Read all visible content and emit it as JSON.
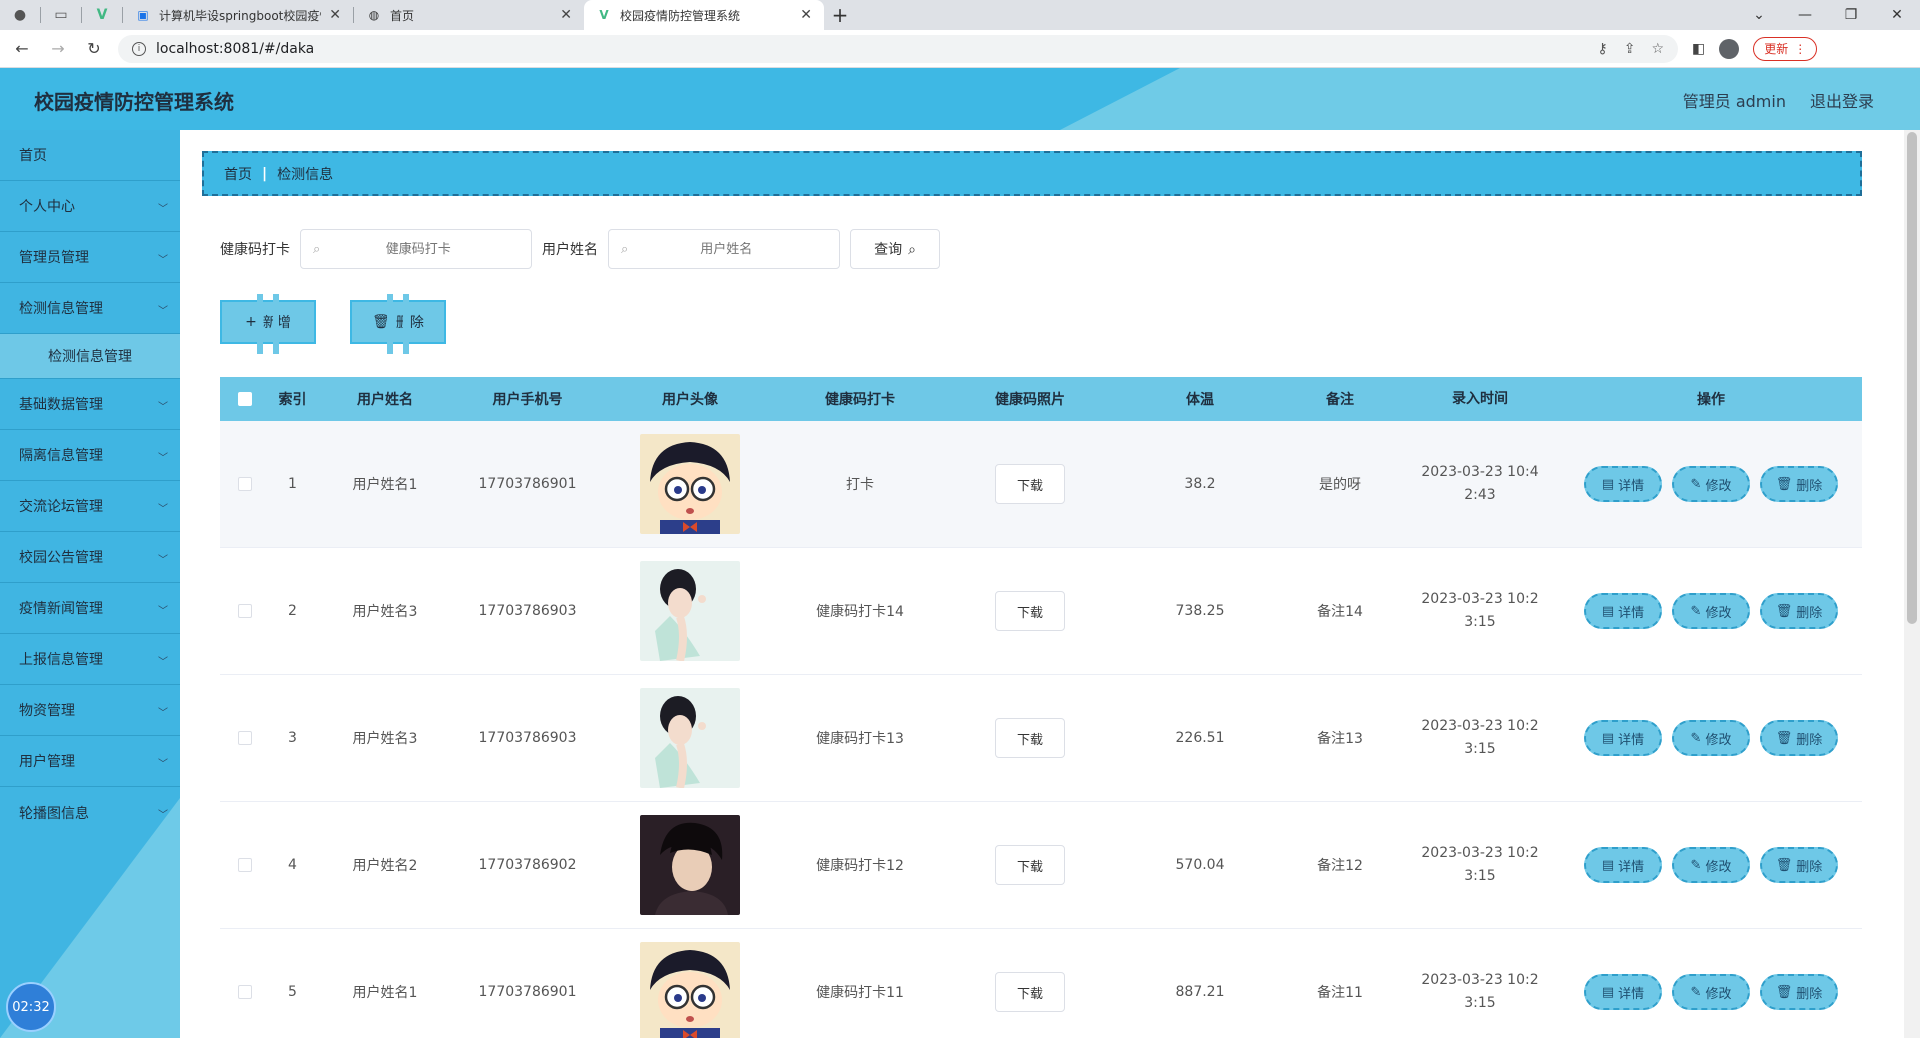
{
  "browser": {
    "tabs": [
      {
        "title": "计算机毕设springboot校园疫情",
        "icon": "calendar-icon"
      },
      {
        "title": "首页",
        "icon": "globe-icon"
      },
      {
        "title": "校园疫情防控管理系统",
        "icon": "vue-icon",
        "active": true
      }
    ],
    "url": "localhost:8081/#/daka",
    "update_label": "更新"
  },
  "header": {
    "title": "校园疫情防控管理系统",
    "user": "管理员 admin",
    "logout": "退出登录"
  },
  "sidebar": {
    "items": [
      {
        "label": "首页"
      },
      {
        "label": "个人中心"
      },
      {
        "label": "管理员管理"
      },
      {
        "label": "检测信息管理"
      },
      {
        "label": "检测信息管理",
        "sub": true
      },
      {
        "label": "基础数据管理"
      },
      {
        "label": "隔离信息管理"
      },
      {
        "label": "交流论坛管理"
      },
      {
        "label": "校园公告管理"
      },
      {
        "label": "疫情新闻管理"
      },
      {
        "label": "上报信息管理"
      },
      {
        "label": "物资管理"
      },
      {
        "label": "用户管理"
      },
      {
        "label": "轮播图信息"
      }
    ],
    "clock": "02:32"
  },
  "breadcrumb": {
    "home": "首页",
    "current": "检测信息"
  },
  "search": {
    "card_label": "健康码打卡",
    "card_placeholder": "健康码打卡",
    "name_label": "用户姓名",
    "name_placeholder": "用户姓名",
    "query_label": "查询"
  },
  "actions": {
    "add": "新增",
    "delete": "删除"
  },
  "table": {
    "headers": [
      "索引",
      "用户姓名",
      "用户手机号",
      "用户头像",
      "健康码打卡",
      "健康码照片",
      "体温",
      "备注",
      "录入时间",
      "操作"
    ],
    "download_label": "下载",
    "op_labels": {
      "detail": "详情",
      "edit": "修改",
      "delete": "删除"
    },
    "rows": [
      {
        "idx": "1",
        "name": "用户姓名1",
        "phone": "17703786901",
        "avatar": "cartoon",
        "card": "打卡",
        "temp": "38.2",
        "remark": "是的呀",
        "time1": "2023-03-23 10:4",
        "time2": "2:43"
      },
      {
        "idx": "2",
        "name": "用户姓名3",
        "phone": "17703786903",
        "avatar": "woman",
        "card": "健康码打卡14",
        "temp": "738.25",
        "remark": "备注14",
        "time1": "2023-03-23 10:2",
        "time2": "3:15"
      },
      {
        "idx": "3",
        "name": "用户姓名3",
        "phone": "17703786903",
        "avatar": "woman",
        "card": "健康码打卡13",
        "temp": "226.51",
        "remark": "备注13",
        "time1": "2023-03-23 10:2",
        "time2": "3:15"
      },
      {
        "idx": "4",
        "name": "用户姓名2",
        "phone": "17703786902",
        "avatar": "man",
        "card": "健康码打卡12",
        "temp": "570.04",
        "remark": "备注12",
        "time1": "2023-03-23 10:2",
        "time2": "3:15"
      },
      {
        "idx": "5",
        "name": "用户姓名1",
        "phone": "17703786901",
        "avatar": "cartoon",
        "card": "健康码打卡11",
        "temp": "887.21",
        "remark": "备注11",
        "time1": "2023-03-23 10:2",
        "time2": "3:15"
      }
    ]
  },
  "colors": {
    "primary": "#3eb8e4",
    "light": "#6ec8e7",
    "border": "#2f9fcb"
  }
}
